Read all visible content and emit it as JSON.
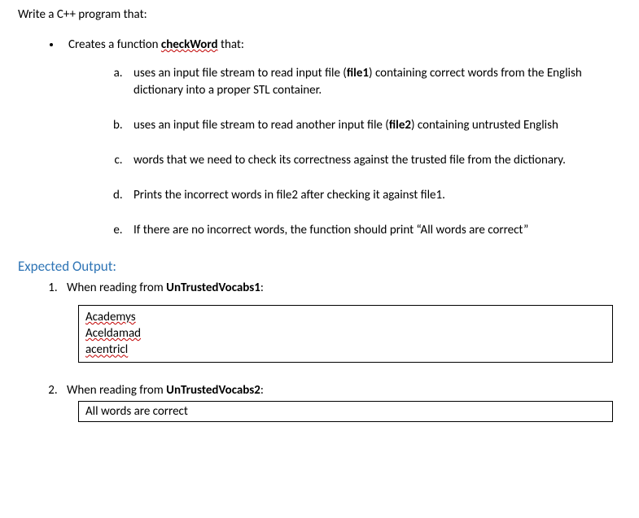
{
  "intro": "Write a C++ program that:",
  "bullet": {
    "prefix": "Creates a function ",
    "func_name": "checkWord",
    "suffix": " that:"
  },
  "subitems": {
    "a_pre": "uses an input file stream to read input file (",
    "a_file": "file1",
    "a_post": ") containing correct words from the English dictionary into a proper STL container.",
    "b_pre": "uses an input file stream to read another input file (",
    "b_file": "file2",
    "b_post": ") containing untrusted English",
    "c": "words that we need to check its correctness against the trusted file from the dictionary.",
    "d": "Prints the incorrect words in file2 after checking it against file1.",
    "e": "If there are no incorrect words, the function should print “All words are correct”"
  },
  "expected_heading": "Expected Output:",
  "output1": {
    "label_pre": "When reading from ",
    "label_file": "UnTrustedVocabs1",
    "label_post": ":",
    "lines": [
      "Academys",
      "Aceldamad",
      "acentricl"
    ]
  },
  "output2": {
    "label_pre": "When reading from ",
    "label_file": "UnTrustedVocabs2",
    "label_post": ":",
    "line": "All words are correct"
  }
}
